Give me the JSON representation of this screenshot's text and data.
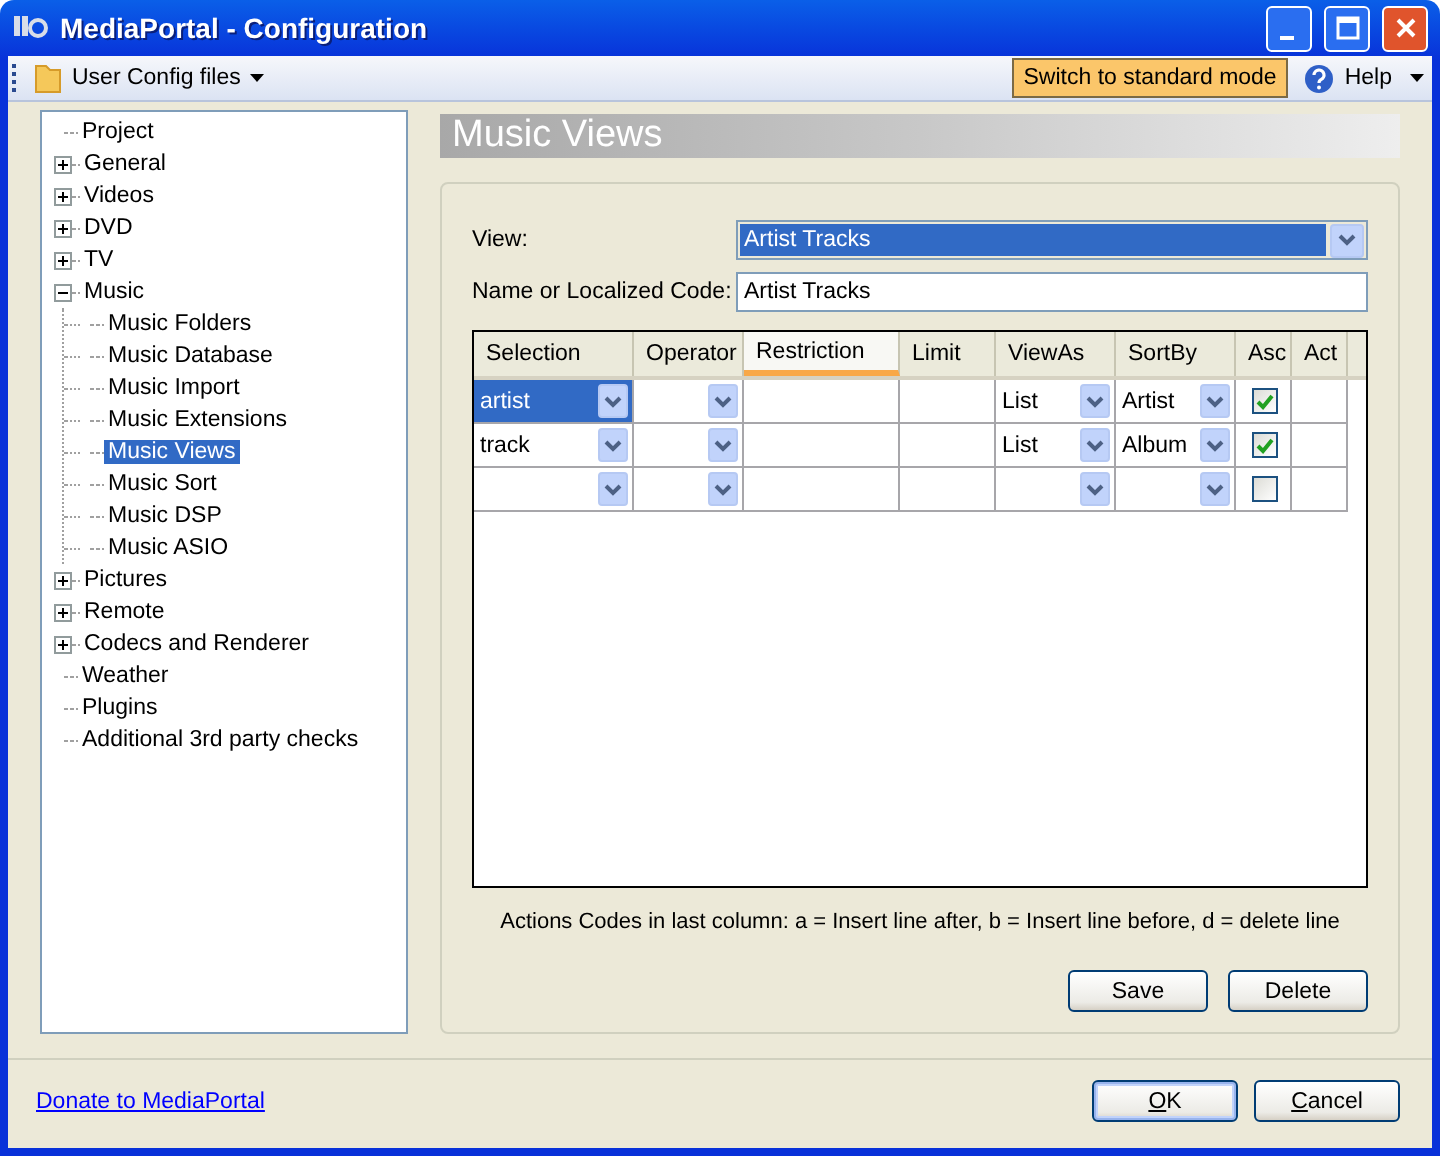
{
  "window": {
    "title": "MediaPortal - Configuration"
  },
  "toolbar": {
    "config_menu": "User Config files",
    "mode_button": "Switch to standard mode",
    "help": "Help"
  },
  "tree": [
    {
      "label": "Project",
      "selected": false
    },
    {
      "label": "General",
      "selected": false,
      "expanded": false
    },
    {
      "label": "Videos",
      "selected": false,
      "expanded": false
    },
    {
      "label": "DVD",
      "selected": false,
      "expanded": false
    },
    {
      "label": "TV",
      "selected": false,
      "expanded": false
    },
    {
      "label": "Music",
      "selected": false,
      "expanded": true,
      "children": [
        {
          "label": "Music Folders",
          "selected": false
        },
        {
          "label": "Music Database",
          "selected": false
        },
        {
          "label": "Music Import",
          "selected": false
        },
        {
          "label": "Music Extensions",
          "selected": false
        },
        {
          "label": "Music Views",
          "selected": true
        },
        {
          "label": "Music Sort",
          "selected": false
        },
        {
          "label": "Music DSP",
          "selected": false
        },
        {
          "label": "Music ASIO",
          "selected": false
        }
      ]
    },
    {
      "label": "Pictures",
      "selected": false,
      "expanded": false
    },
    {
      "label": "Remote",
      "selected": false,
      "expanded": false
    },
    {
      "label": "Codecs and Renderer",
      "selected": false,
      "expanded": false
    },
    {
      "label": "Weather",
      "selected": false
    },
    {
      "label": "Plugins",
      "selected": false
    },
    {
      "label": "Additional 3rd party checks",
      "selected": false
    }
  ],
  "page_title": "Music Views",
  "view": {
    "label": "View:",
    "value": "Artist Tracks"
  },
  "name": {
    "label": "Name or Localized Code:",
    "value": "Artist Tracks"
  },
  "grid": {
    "columns": [
      {
        "label": "Selection",
        "kind": "combo",
        "highlighted": false
      },
      {
        "label": "Operator",
        "kind": "combo",
        "highlighted": false
      },
      {
        "label": "Restriction",
        "kind": "text",
        "highlighted": true
      },
      {
        "label": "Limit",
        "kind": "text",
        "highlighted": false
      },
      {
        "label": "ViewAs",
        "kind": "combo",
        "highlighted": false
      },
      {
        "label": "SortBy",
        "kind": "combo",
        "highlighted": false
      },
      {
        "label": "Asc",
        "kind": "check",
        "highlighted": false
      },
      {
        "label": "Act",
        "kind": "text",
        "highlighted": false
      }
    ],
    "rows": [
      {
        "cells": [
          "artist",
          "",
          "",
          "",
          "List",
          "Artist",
          null,
          ""
        ],
        "asc": true,
        "selected": true
      },
      {
        "cells": [
          "track",
          "",
          "",
          "",
          "List",
          "Album",
          null,
          ""
        ],
        "asc": true,
        "selected": false
      },
      {
        "cells": [
          "",
          "",
          "",
          "",
          "",
          "",
          null,
          ""
        ],
        "asc": false,
        "selected": false
      }
    ]
  },
  "note": "Actions Codes in last column: a = Insert line after, b = Insert line before, d = delete line",
  "save_button": "Save",
  "delete_button": "Delete",
  "donate_link": "Donate to MediaPortal",
  "ok_button": "OK",
  "cancel_button": "Cancel"
}
